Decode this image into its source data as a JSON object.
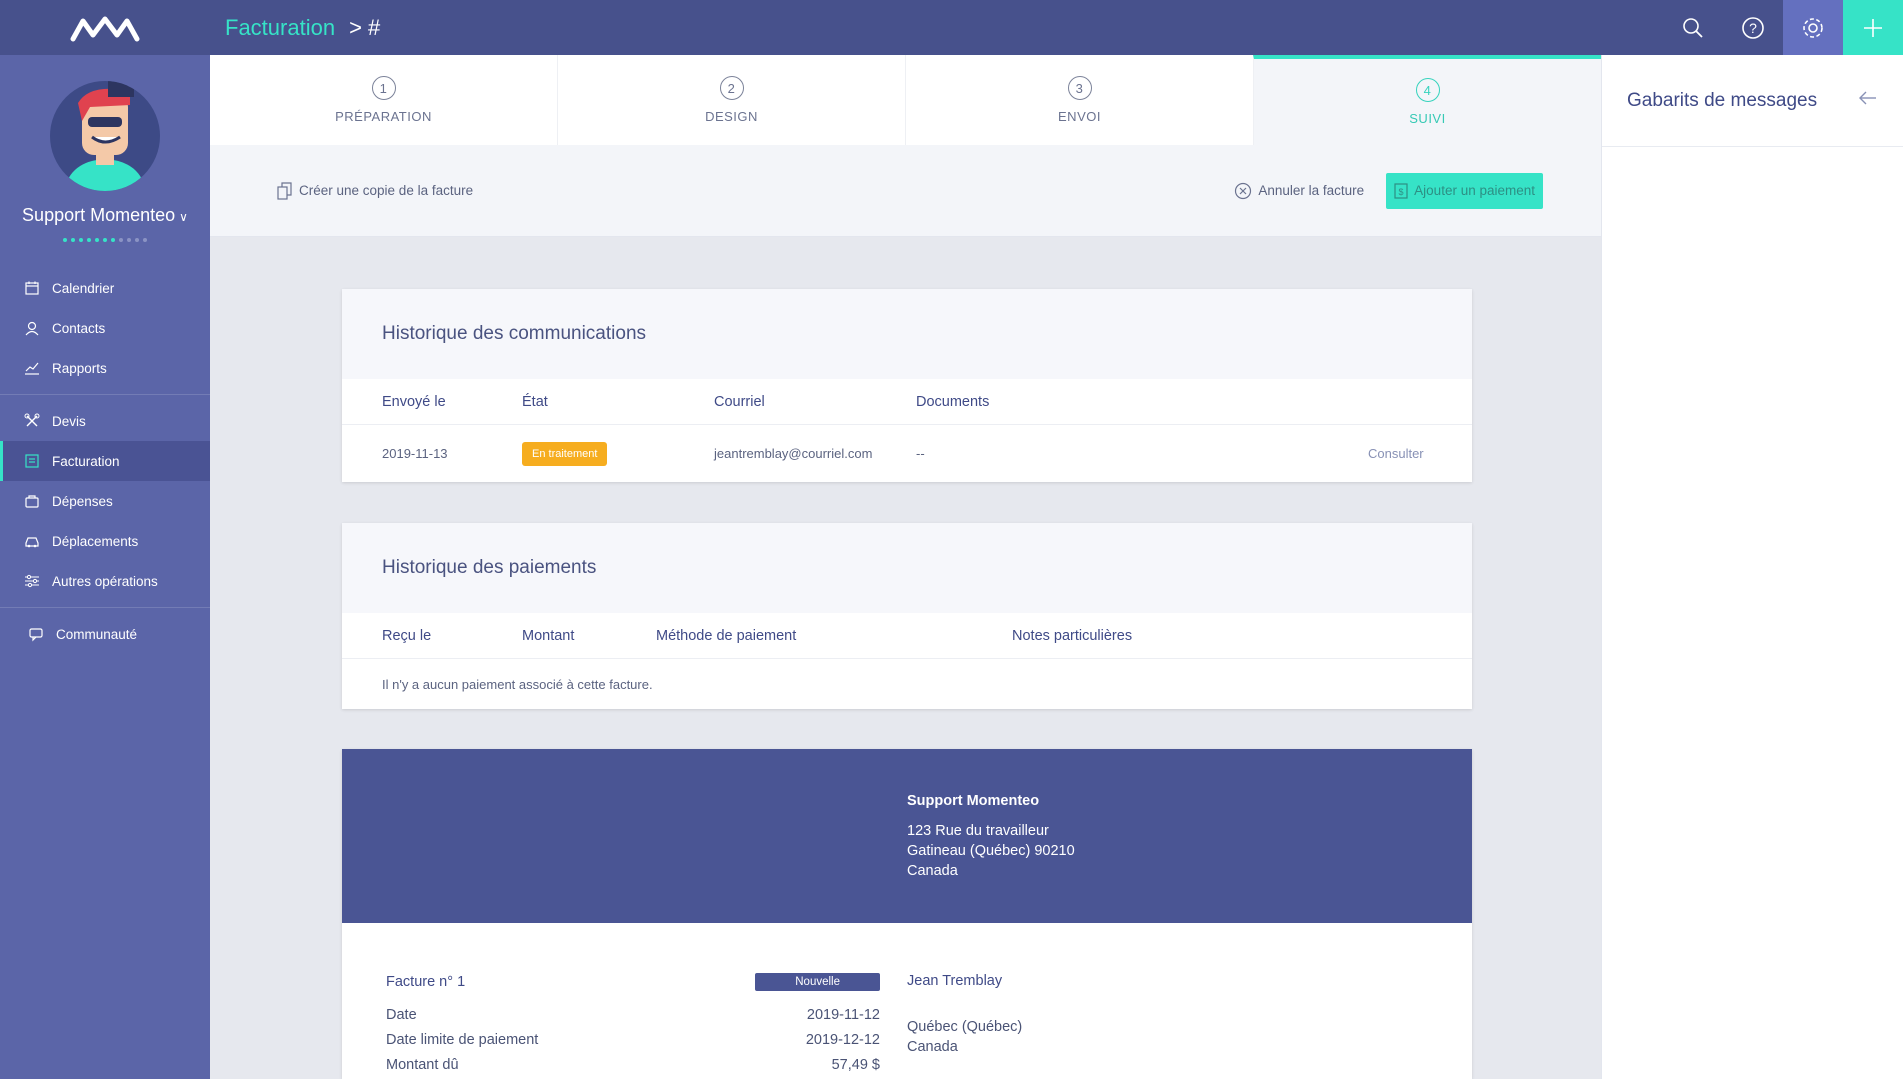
{
  "topbar": {
    "breadcrumb_section": "Facturation",
    "breadcrumb_sep": "> #"
  },
  "sidebar": {
    "user_name": "Support Momenteo",
    "groups": [
      [
        {
          "label": "Calendrier",
          "icon": "calendar-icon"
        },
        {
          "label": "Contacts",
          "icon": "user-icon"
        },
        {
          "label": "Rapports",
          "icon": "chart-icon"
        }
      ],
      [
        {
          "label": "Devis",
          "icon": "tools-icon"
        },
        {
          "label": "Facturation",
          "icon": "invoice-icon",
          "active": true
        },
        {
          "label": "Dépenses",
          "icon": "bag-icon"
        },
        {
          "label": "Déplacements",
          "icon": "car-icon"
        },
        {
          "label": "Autres opérations",
          "icon": "sliders-icon"
        }
      ],
      [
        {
          "label": "Communauté",
          "icon": "chat-icon"
        }
      ]
    ]
  },
  "steps": [
    {
      "num": "1",
      "label": "PRÉPARATION"
    },
    {
      "num": "2",
      "label": "DESIGN"
    },
    {
      "num": "3",
      "label": "ENVOI"
    },
    {
      "num": "4",
      "label": "SUIVI",
      "active": true
    }
  ],
  "actions": {
    "copy": "Créer une copie de la facture",
    "cancel": "Annuler la facture",
    "add_payment": "Ajouter un paiement"
  },
  "communications": {
    "title": "Historique des communications",
    "headers": [
      "Envoyé le",
      "État",
      "Courriel",
      "Documents"
    ],
    "rows": [
      {
        "date": "2019-11-13",
        "state": "En traitement",
        "email": "jeantremblay@courriel.com",
        "documents": "--",
        "action": "Consulter"
      }
    ]
  },
  "payments": {
    "title": "Historique des paiements",
    "headers": [
      "Reçu le",
      "Montant",
      "Méthode de paiement",
      "Notes particulières"
    ],
    "empty": "Il n'y a aucun paiement associé à cette facture."
  },
  "invoice": {
    "company": {
      "name": "Support Momenteo",
      "address1": "123 Rue du travailleur",
      "address2": "Gatineau (Québec) 90210",
      "country": "Canada"
    },
    "number_label": "Facture n° 1",
    "status": "Nouvelle",
    "date_label": "Date",
    "date_value": "2019-11-12",
    "due_label": "Date limite de paiement",
    "due_value": "2019-12-12",
    "amount_label": "Montant dû",
    "amount_value": "57,49 $",
    "client": {
      "name": "Jean Tremblay",
      "city": "Québec (Québec)",
      "country": "Canada"
    }
  },
  "right_panel": {
    "title": "Gabarits de messages"
  },
  "colors": {
    "accent": "#36e3c7",
    "sidebar": "#5b65a8",
    "topbar": "#47518c",
    "badge_processing": "#f6ad1f"
  }
}
